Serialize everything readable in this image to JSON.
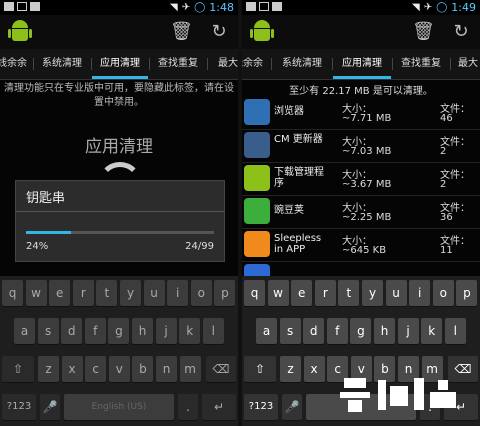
{
  "left": {
    "status": {
      "time": "1:48"
    },
    "tabs": [
      {
        "label": "线余余"
      },
      {
        "label": "系统清理"
      },
      {
        "label": "应用清理",
        "active": true
      },
      {
        "label": "查找重复"
      },
      {
        "label": "最大"
      }
    ],
    "notice": "清理功能只在专业版中可用，要隐藏此标签，请在设置中禁用。",
    "big_title": "应用清理",
    "dialog": {
      "title": "钥匙串",
      "percent_text": "24%",
      "count_text": "24/99",
      "progress_fraction": 0.24
    },
    "keyboard": {
      "row1": [
        "q",
        "w",
        "e",
        "r",
        "t",
        "y",
        "u",
        "i",
        "o",
        "p"
      ],
      "row2": [
        "a",
        "s",
        "d",
        "f",
        "g",
        "h",
        "j",
        "k",
        "l"
      ],
      "row3": [
        "z",
        "x",
        "c",
        "v",
        "b",
        "n",
        "m"
      ],
      "sym_key": "?123",
      "space_hint": "English (US)"
    }
  },
  "right": {
    "status": {
      "time": "1:49"
    },
    "tabs": [
      {
        "label": "线余余"
      },
      {
        "label": "系统清理"
      },
      {
        "label": "应用清理",
        "active": true
      },
      {
        "label": "查找重复"
      },
      {
        "label": "最大"
      }
    ],
    "info": "至少有 22.17 MB 是可以清理。",
    "size_label": "大小：",
    "files_label": "文件：",
    "apps": [
      {
        "name": "浏览器",
        "size": "~7.71 MB",
        "files": "46",
        "icon": "globe-icon",
        "color": "#2f6fb3"
      },
      {
        "name": "CM 更新器",
        "size": "~7.03 MB",
        "files": "2",
        "icon": "gear-icon",
        "color": "#3a5e8c"
      },
      {
        "name": "下载管理程序",
        "size": "~3.67 MB",
        "files": "2",
        "icon": "android-icon",
        "color": "#8ec01a"
      },
      {
        "name": "豌豆荚",
        "size": "~2.25 MB",
        "files": "36",
        "icon": "wandoujia-icon",
        "color": "#3cae3c"
      },
      {
        "name": "Sleepless in APP",
        "size": "~645 KB",
        "files": "11",
        "icon": "sun-icon",
        "color": "#f08a1c"
      },
      {
        "name": "",
        "size": "",
        "files": "",
        "icon": "google-icon",
        "color": "#2d6ad6"
      }
    ],
    "keyboard": {
      "row1": [
        "q",
        "w",
        "e",
        "r",
        "t",
        "y",
        "u",
        "i",
        "o",
        "p"
      ],
      "row2": [
        "a",
        "s",
        "d",
        "f",
        "g",
        "h",
        "j",
        "k",
        "l"
      ],
      "row3": [
        "z",
        "x",
        "c",
        "v",
        "b",
        "n",
        "m"
      ],
      "sym_key": "?123"
    }
  }
}
